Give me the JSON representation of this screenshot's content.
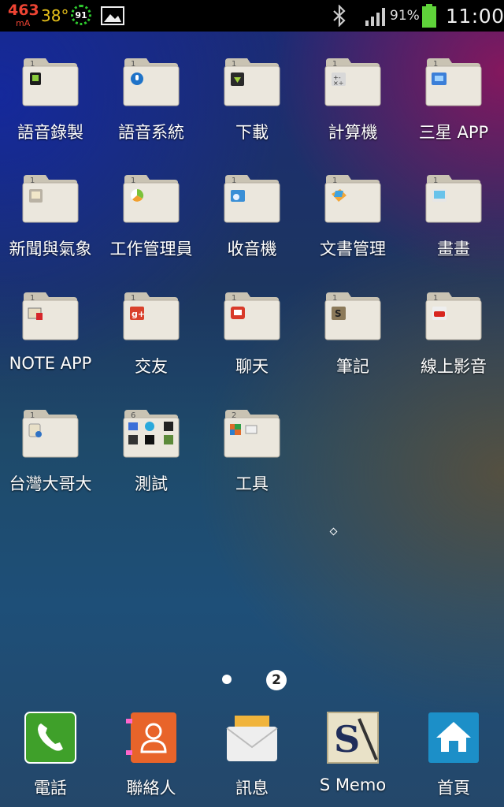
{
  "status_bar": {
    "current": "463",
    "current_unit": "mA",
    "temperature": "38°",
    "battery_circle": "91",
    "battery_percent": "91%",
    "time": "11:00"
  },
  "folders": [
    {
      "label": "語音錄製",
      "count": "1",
      "icon": "voice-recorder-icon"
    },
    {
      "label": "語音系統",
      "count": "1",
      "icon": "microphone-icon"
    },
    {
      "label": "下載",
      "count": "1",
      "icon": "download-icon"
    },
    {
      "label": "計算機",
      "count": "1",
      "icon": "calculator-icon"
    },
    {
      "label": "三星 APP",
      "count": "1",
      "icon": "samsung-apps-icon"
    },
    {
      "label": "新聞與氣象",
      "count": "1",
      "icon": "news-weather-icon"
    },
    {
      "label": "工作管理員",
      "count": "1",
      "icon": "task-manager-icon"
    },
    {
      "label": "收音機",
      "count": "1",
      "icon": "radio-icon"
    },
    {
      "label": "文書管理",
      "count": "1",
      "icon": "documents-icon"
    },
    {
      "label": "畫畫",
      "count": "1",
      "icon": "paint-icon"
    },
    {
      "label": "NOTE APP",
      "count": "1",
      "icon": "note-app-icon"
    },
    {
      "label": "交友",
      "count": "1",
      "icon": "google-plus-icon"
    },
    {
      "label": "聊天",
      "count": "1",
      "icon": "chat-icon"
    },
    {
      "label": "筆記",
      "count": "1",
      "icon": "s-note-icon"
    },
    {
      "label": "線上影音",
      "count": "1",
      "icon": "youtube-icon"
    },
    {
      "label": "台灣大哥大",
      "count": "1",
      "icon": "taiwan-mobile-icon"
    },
    {
      "label": "測試",
      "count": "6",
      "icon": "test-apps-icon"
    },
    {
      "label": "工具",
      "count": "2",
      "icon": "tools-icon"
    }
  ],
  "pager": {
    "current_page": "2"
  },
  "dock": [
    {
      "label": "電話",
      "icon": "phone-icon",
      "color": "#3fa02a"
    },
    {
      "label": "聯絡人",
      "icon": "contacts-icon",
      "color": "#e8642a"
    },
    {
      "label": "訊息",
      "icon": "messages-icon",
      "color": "#f0b43c"
    },
    {
      "label": "S Memo",
      "icon": "s-memo-icon",
      "color": "#e9e2c8"
    },
    {
      "label": "首頁",
      "icon": "home-icon",
      "color": "#1c8fc8"
    }
  ]
}
